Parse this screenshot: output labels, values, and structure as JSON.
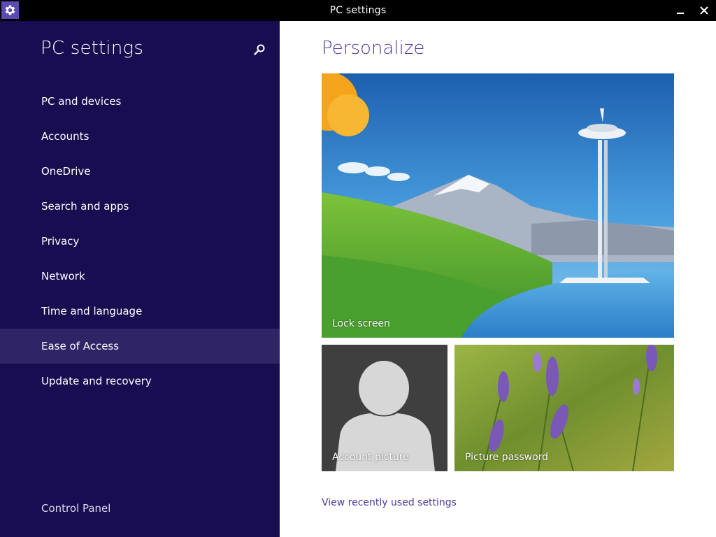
{
  "window": {
    "title": "PC settings",
    "minimize_glyph": "—",
    "close_glyph": "✕"
  },
  "sidebar": {
    "title": "PC settings",
    "search_icon": "search-icon",
    "items": [
      {
        "label": "PC and devices"
      },
      {
        "label": "Accounts"
      },
      {
        "label": "OneDrive"
      },
      {
        "label": "Search and apps"
      },
      {
        "label": "Privacy"
      },
      {
        "label": "Network"
      },
      {
        "label": "Time and language"
      },
      {
        "label": "Ease of Access",
        "selected": true
      },
      {
        "label": "Update and recovery"
      }
    ],
    "footer_link": "Control Panel"
  },
  "main": {
    "title": "Personalize",
    "tiles": {
      "lock_screen": {
        "label": "Lock screen"
      },
      "account_picture": {
        "label": "Account picture"
      },
      "picture_password": {
        "label": "Picture password"
      }
    },
    "recent_link": "View recently used settings"
  },
  "colors": {
    "sidebar_bg": "#180d50",
    "selected_item_bg": "#2f2466",
    "accent": "#4a3c9c",
    "titlebar_bg": "#000000",
    "app_icon_bg": "#5b4bb5"
  }
}
